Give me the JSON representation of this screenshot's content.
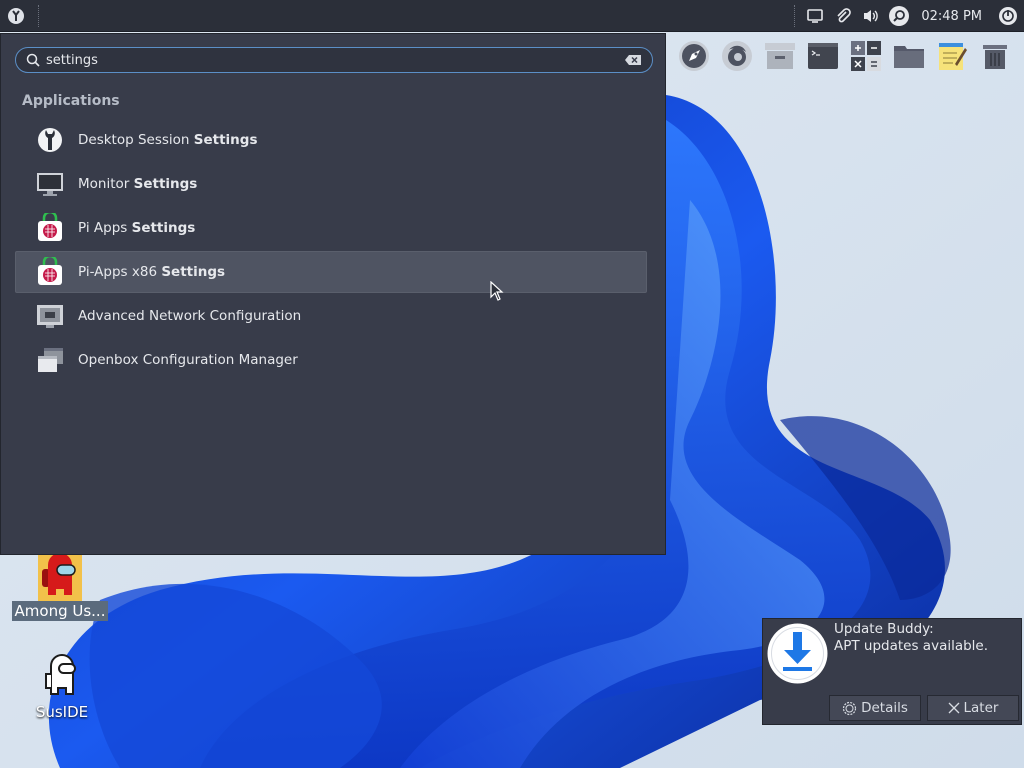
{
  "desktop": {
    "icons": [
      {
        "label": "Among Us...",
        "icon": "among-us-icon",
        "selected": true
      },
      {
        "label": "SusIDE",
        "icon": "suside-icon",
        "selected": false
      }
    ]
  },
  "top_panel": {
    "menu_icon": "raspberry-menu-icon",
    "tray_icons": [
      "display-icon",
      "attachment-icon",
      "volume-icon",
      "search-icon"
    ],
    "clock": "02:48 PM",
    "power_icon": "power-icon"
  },
  "dock": {
    "items": [
      "rocket-launcher-icon",
      "firefox-icon",
      "archive-manager-icon",
      "terminal-icon",
      "calculator-icon",
      "file-manager-icon",
      "text-editor-icon",
      "trash-icon"
    ]
  },
  "app_menu": {
    "search": {
      "value": "settings",
      "placeholder": ""
    },
    "section_header": "Applications",
    "results": [
      {
        "prefix": "Desktop Session ",
        "match": "Settings",
        "icon": "session-settings-icon",
        "selected": false
      },
      {
        "prefix": "Monitor ",
        "match": "Settings",
        "icon": "monitor-icon",
        "selected": false
      },
      {
        "prefix": "Pi Apps ",
        "match": "Settings",
        "icon": "pi-apps-icon",
        "selected": false
      },
      {
        "prefix": "Pi-Apps x86 ",
        "match": "Settings",
        "icon": "pi-apps-icon",
        "selected": true
      },
      {
        "prefix": "Advanced Network Configuration",
        "match": "",
        "icon": "network-icon",
        "selected": false
      },
      {
        "prefix": "Openbox Configuration Manager",
        "match": "",
        "icon": "openbox-icon",
        "selected": false
      }
    ]
  },
  "notification": {
    "title": "Update Buddy:",
    "body": "APT updates available.",
    "details_label": "Details",
    "later_label": "Later",
    "icon": "download-icon"
  },
  "colors": {
    "panel_bg": "#2b2f39",
    "menu_bg": "#383c4a",
    "accent": "#5b8fc7",
    "selected_row": "#4f5462"
  }
}
